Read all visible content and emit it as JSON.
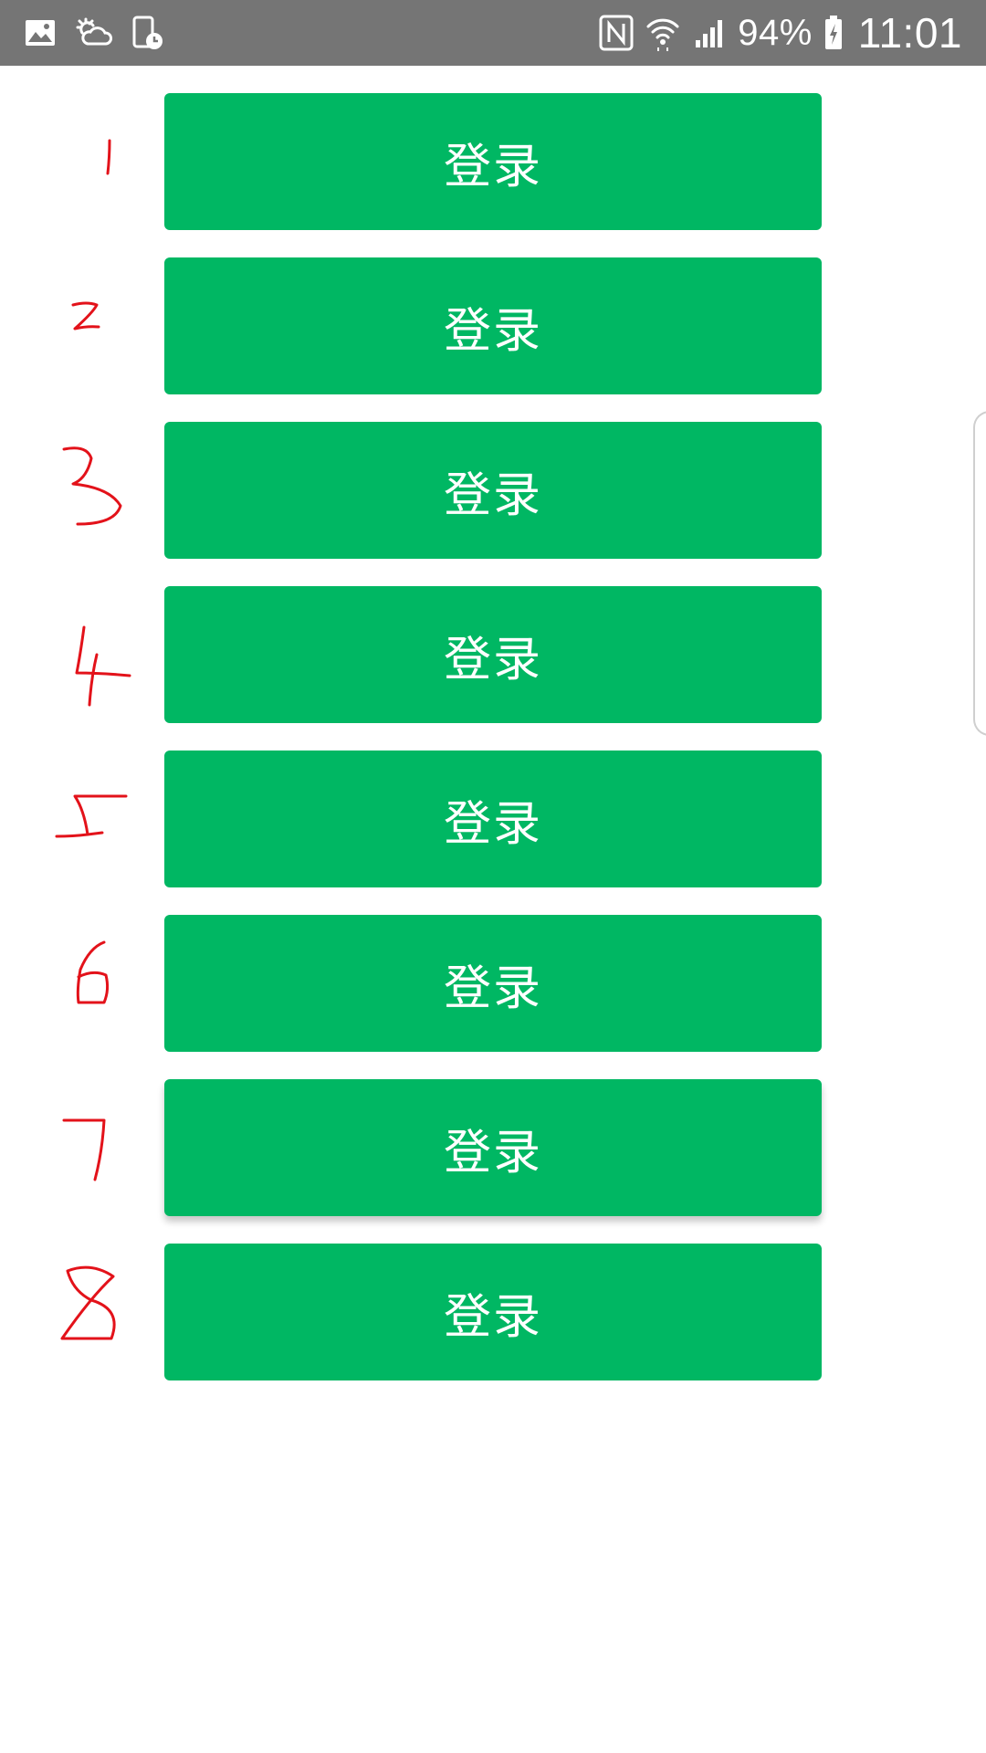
{
  "status_bar": {
    "left_icons": [
      "gallery-icon",
      "weather-icon",
      "screen-timer-icon"
    ],
    "right_icons": [
      "nfc-icon",
      "wifi-icon",
      "signal-icon"
    ],
    "battery_percent": "94%",
    "battery_charging": true,
    "time": "11:01",
    "background_color": "#757575"
  },
  "buttons": [
    {
      "label": "登录",
      "annotation": "1"
    },
    {
      "label": "登录",
      "annotation": "2"
    },
    {
      "label": "登录",
      "annotation": "3"
    },
    {
      "label": "登录",
      "annotation": "4"
    },
    {
      "label": "登录",
      "annotation": "5"
    },
    {
      "label": "登录",
      "annotation": "6"
    },
    {
      "label": "登录",
      "annotation": "7"
    },
    {
      "label": "登录",
      "annotation": "8"
    }
  ],
  "colors": {
    "button": "#00b763",
    "button_text": "#ffffff",
    "annotation": "#e3121a"
  }
}
